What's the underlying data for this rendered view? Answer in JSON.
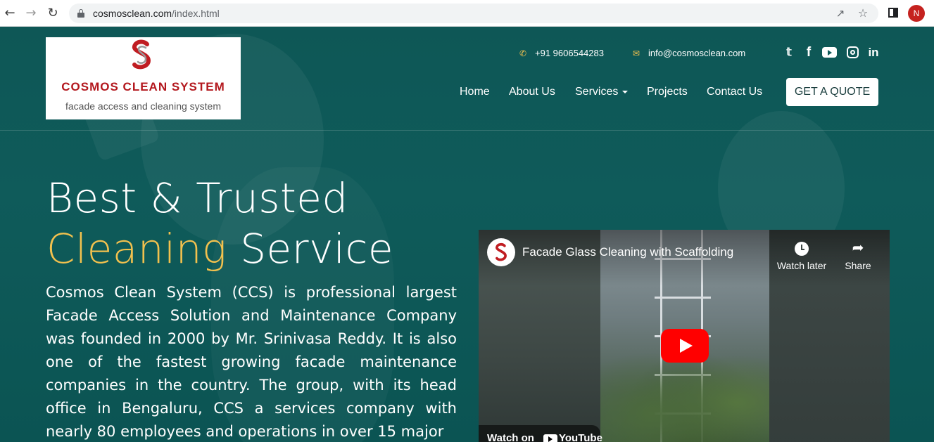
{
  "browser": {
    "url_host": "cosmosclean.com",
    "url_path": "/index.html",
    "profile_initial": "N"
  },
  "header": {
    "logo": {
      "title": "COSMOS CLEAN SYSTEM",
      "subtitle": "facade access and cleaning system"
    },
    "phone": "+91 9606544283",
    "email": "info@cosmosclean.com",
    "social": [
      "twitter-icon",
      "facebook-icon",
      "youtube-icon",
      "instagram-icon",
      "linkedin-icon"
    ],
    "nav": {
      "home": "Home",
      "about": "About Us",
      "services": "Services",
      "projects": "Projects",
      "contact": "Contact Us"
    },
    "cta": "GET A QUOTE"
  },
  "hero": {
    "line1": "Best & Trusted",
    "line2_highlight": "Cleaning",
    "line2_rest": " Service",
    "description": "Cosmos Clean System (CCS) is professional largest Facade Access Solution and Maintenance Company was founded in 2000 by Mr. Srinivasa Reddy. It is also one of the fastest growing facade maintenance companies in the country. The group, with its head office in Bengaluru, CCS a services company with nearly 80 employees and operations in over 15 major"
  },
  "video": {
    "title": "Facade Glass Cleaning with Scaffolding",
    "watch_later": "Watch later",
    "share": "Share",
    "watch_on": "Watch on",
    "youtube": "YouTube"
  },
  "colors": {
    "background": "#0f5a5a",
    "accent_gold": "#f2c14e",
    "brand_red": "#b3171d",
    "youtube_red": "#ff0000"
  }
}
